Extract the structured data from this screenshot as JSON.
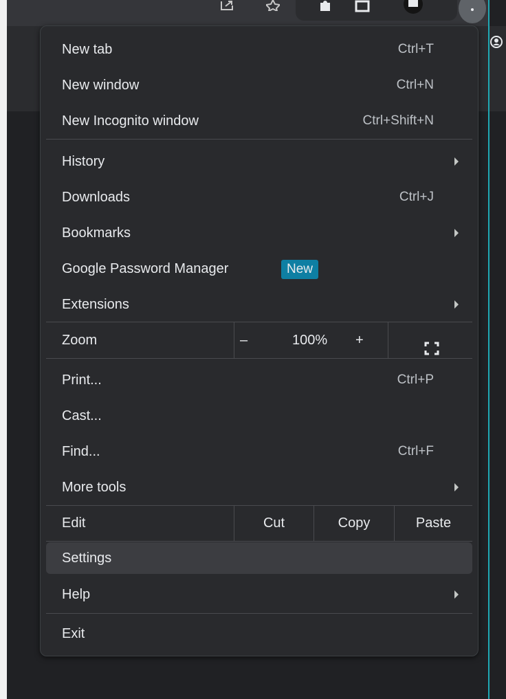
{
  "menu": {
    "new_tab": {
      "label": "New tab",
      "shortcut": "Ctrl+T"
    },
    "new_window": {
      "label": "New window",
      "shortcut": "Ctrl+N"
    },
    "new_incognito": {
      "label": "New Incognito window",
      "shortcut": "Ctrl+Shift+N"
    },
    "history": {
      "label": "History"
    },
    "downloads": {
      "label": "Downloads",
      "shortcut": "Ctrl+J"
    },
    "bookmarks": {
      "label": "Bookmarks"
    },
    "password_manager": {
      "label": "Google Password Manager",
      "badge": "New"
    },
    "extensions": {
      "label": "Extensions"
    },
    "zoom": {
      "label": "Zoom",
      "minus": "–",
      "value": "100%",
      "plus": "+"
    },
    "print": {
      "label": "Print...",
      "shortcut": "Ctrl+P"
    },
    "cast": {
      "label": "Cast..."
    },
    "find": {
      "label": "Find...",
      "shortcut": "Ctrl+F"
    },
    "more_tools": {
      "label": "More tools"
    },
    "edit": {
      "label": "Edit",
      "cut": "Cut",
      "copy": "Copy",
      "paste": "Paste"
    },
    "settings": {
      "label": "Settings"
    },
    "help": {
      "label": "Help"
    },
    "exit": {
      "label": "Exit"
    }
  },
  "icons": {
    "share": "share-icon",
    "bookmark_star": "star-icon",
    "extensions": "puzzle-icon",
    "sidepanel": "side-panel-icon",
    "profile": "profile-icon",
    "more": "more-vert-icon",
    "fullscreen": "fullscreen-icon"
  },
  "colors": {
    "menu_bg": "#292a2d",
    "badge_bg": "#0e7fa3",
    "accent_line": "#1fa9b5",
    "selected_bg": "#3c3d41"
  }
}
